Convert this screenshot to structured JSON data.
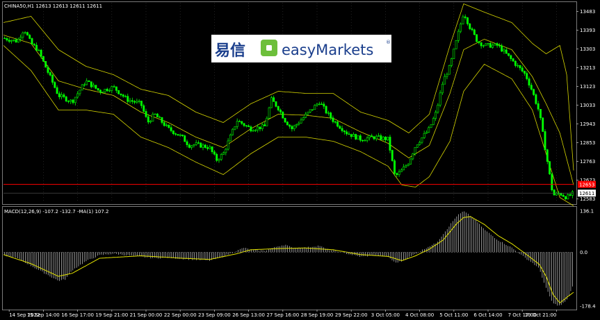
{
  "header": {
    "symbol_line": "CHINA50,H1  12613 12613 12611 12611",
    "macd_line": "MACD(12,26,9) -107.2 -132.7  -MA(1) 107.2"
  },
  "logo": {
    "cn_text": "易信",
    "brand_text": "easyMarkets",
    "reg_mark": "®"
  },
  "colors": {
    "background": "#000000",
    "bull": "#00ff00",
    "band": "#d7d700",
    "grid": "#3a3a3a",
    "level_line": "#ff0000",
    "macd_hist": "#d0d0d0",
    "signal": "#e6e600",
    "logo_blue": "#1a3e8c",
    "logo_green": "#6dbf3b"
  },
  "chart_data": [
    {
      "type": "candlestick",
      "ylim": [
        12565,
        13525
      ],
      "y_ticks": [
        13483,
        13393,
        13303,
        13213,
        13123,
        13033,
        12943,
        12853,
        12763,
        12673,
        12583
      ],
      "current_price": 12611,
      "current_price_label": "12611",
      "level_price": 12653,
      "level_price_label": "12653",
      "close_path": [
        [
          0,
          13355
        ],
        [
          2,
          13340
        ],
        [
          3,
          13400
        ],
        [
          4,
          13330
        ],
        [
          5,
          13300
        ],
        [
          8,
          13080
        ],
        [
          10,
          13050
        ],
        [
          12,
          13150
        ],
        [
          14,
          13100
        ],
        [
          16,
          13120
        ],
        [
          18,
          13060
        ],
        [
          20,
          13040
        ],
        [
          21,
          12950
        ],
        [
          22,
          12990
        ],
        [
          24,
          12920
        ],
        [
          26,
          12880
        ],
        [
          27,
          12840
        ],
        [
          28,
          12845
        ],
        [
          30,
          12830
        ],
        [
          31,
          12770
        ],
        [
          32,
          12800
        ],
        [
          34,
          12960
        ],
        [
          35,
          12940
        ],
        [
          36,
          12920
        ],
        [
          38,
          12930
        ],
        [
          39,
          13060
        ],
        [
          40,
          13020
        ],
        [
          41,
          12960
        ],
        [
          42,
          12920
        ],
        [
          44,
          12985
        ],
        [
          46,
          13050
        ],
        [
          47,
          13000
        ],
        [
          48,
          12960
        ],
        [
          50,
          12900
        ],
        [
          52,
          12870
        ],
        [
          54,
          12880
        ],
        [
          56,
          12870
        ],
        [
          57,
          12690
        ],
        [
          58,
          12720
        ],
        [
          59,
          12760
        ],
        [
          60,
          12840
        ],
        [
          62,
          12920
        ],
        [
          63,
          13000
        ],
        [
          64,
          13150
        ],
        [
          65,
          13220
        ],
        [
          66,
          13350
        ],
        [
          67,
          13480
        ],
        [
          68,
          13400
        ],
        [
          69,
          13340
        ],
        [
          70,
          13320
        ],
        [
          72,
          13320
        ],
        [
          74,
          13250
        ],
        [
          76,
          13180
        ],
        [
          77,
          13100
        ],
        [
          78,
          13000
        ],
        [
          79,
          12800
        ],
        [
          80,
          12600
        ],
        [
          81,
          12610
        ],
        [
          82,
          12590
        ],
        [
          83,
          12611
        ]
      ],
      "upper_band": [
        [
          0,
          13430
        ],
        [
          4,
          13460
        ],
        [
          8,
          13300
        ],
        [
          12,
          13220
        ],
        [
          16,
          13180
        ],
        [
          20,
          13110
        ],
        [
          24,
          13080
        ],
        [
          28,
          13000
        ],
        [
          32,
          12950
        ],
        [
          36,
          13040
        ],
        [
          40,
          13100
        ],
        [
          44,
          13090
        ],
        [
          48,
          13090
        ],
        [
          52,
          13000
        ],
        [
          56,
          12960
        ],
        [
          59,
          12900
        ],
        [
          62,
          12990
        ],
        [
          65,
          13320
        ],
        [
          67,
          13520
        ],
        [
          70,
          13480
        ],
        [
          74,
          13430
        ],
        [
          77,
          13330
        ],
        [
          79,
          13280
        ],
        [
          81,
          13320
        ],
        [
          82,
          13180
        ],
        [
          83,
          12720
        ]
      ],
      "lower_band": [
        [
          0,
          13320
        ],
        [
          4,
          13200
        ],
        [
          8,
          13010
        ],
        [
          12,
          13010
        ],
        [
          16,
          12990
        ],
        [
          20,
          12880
        ],
        [
          24,
          12830
        ],
        [
          28,
          12760
        ],
        [
          32,
          12700
        ],
        [
          36,
          12800
        ],
        [
          40,
          12880
        ],
        [
          44,
          12880
        ],
        [
          48,
          12860
        ],
        [
          52,
          12810
        ],
        [
          56,
          12740
        ],
        [
          58,
          12650
        ],
        [
          60,
          12640
        ],
        [
          62,
          12690
        ],
        [
          65,
          12860
        ],
        [
          67,
          13100
        ],
        [
          70,
          13230
        ],
        [
          74,
          13160
        ],
        [
          77,
          13010
        ],
        [
          79,
          12800
        ],
        [
          81,
          12590
        ],
        [
          83,
          12550
        ]
      ],
      "middle_band": [
        [
          0,
          13370
        ],
        [
          4,
          13330
        ],
        [
          8,
          13150
        ],
        [
          12,
          13110
        ],
        [
          16,
          13080
        ],
        [
          20,
          13000
        ],
        [
          24,
          12950
        ],
        [
          28,
          12880
        ],
        [
          32,
          12830
        ],
        [
          36,
          12920
        ],
        [
          40,
          12990
        ],
        [
          44,
          12985
        ],
        [
          48,
          12970
        ],
        [
          52,
          12905
        ],
        [
          56,
          12850
        ],
        [
          59,
          12780
        ],
        [
          62,
          12840
        ],
        [
          65,
          13090
        ],
        [
          67,
          13300
        ],
        [
          70,
          13350
        ],
        [
          74,
          13300
        ],
        [
          77,
          13170
        ],
        [
          79,
          13040
        ],
        [
          81,
          12900
        ],
        [
          83,
          12650
        ]
      ]
    },
    {
      "type": "bar",
      "ylim": [
        -188,
        148
      ],
      "y_ticks": [
        136.1,
        0.0,
        -178.4
      ],
      "histogram": [
        [
          0,
          -10
        ],
        [
          2,
          -20
        ],
        [
          4,
          -45
        ],
        [
          6,
          -70
        ],
        [
          8,
          -95
        ],
        [
          9,
          -90
        ],
        [
          10,
          -60
        ],
        [
          12,
          -30
        ],
        [
          14,
          -10
        ],
        [
          16,
          -5
        ],
        [
          18,
          -10
        ],
        [
          20,
          -15
        ],
        [
          22,
          -20
        ],
        [
          24,
          -18
        ],
        [
          26,
          -22
        ],
        [
          28,
          -25
        ],
        [
          30,
          -28
        ],
        [
          32,
          -15
        ],
        [
          34,
          5
        ],
        [
          35,
          15
        ],
        [
          36,
          8
        ],
        [
          38,
          5
        ],
        [
          40,
          20
        ],
        [
          41,
          25
        ],
        [
          42,
          15
        ],
        [
          44,
          15
        ],
        [
          46,
          22
        ],
        [
          47,
          10
        ],
        [
          48,
          5
        ],
        [
          50,
          -5
        ],
        [
          52,
          -15
        ],
        [
          54,
          -10
        ],
        [
          56,
          -15
        ],
        [
          57,
          -35
        ],
        [
          58,
          -30
        ],
        [
          60,
          -5
        ],
        [
          62,
          20
        ],
        [
          63,
          30
        ],
        [
          64,
          60
        ],
        [
          65,
          90
        ],
        [
          66,
          120
        ],
        [
          67,
          136
        ],
        [
          68,
          120
        ],
        [
          69,
          100
        ],
        [
          70,
          75
        ],
        [
          72,
          40
        ],
        [
          74,
          15
        ],
        [
          76,
          -20
        ],
        [
          77,
          -35
        ],
        [
          78,
          -55
        ],
        [
          79,
          -120
        ],
        [
          80,
          -170
        ],
        [
          81,
          -178
        ],
        [
          82,
          -160
        ],
        [
          83,
          -107
        ]
      ],
      "signal": [
        [
          0,
          -8
        ],
        [
          4,
          -38
        ],
        [
          8,
          -80
        ],
        [
          10,
          -70
        ],
        [
          14,
          -20
        ],
        [
          20,
          -12
        ],
        [
          26,
          -20
        ],
        [
          30,
          -24
        ],
        [
          34,
          -5
        ],
        [
          36,
          8
        ],
        [
          40,
          12
        ],
        [
          44,
          14
        ],
        [
          48,
          8
        ],
        [
          52,
          -8
        ],
        [
          56,
          -14
        ],
        [
          58,
          -28
        ],
        [
          60,
          -12
        ],
        [
          62,
          10
        ],
        [
          64,
          40
        ],
        [
          66,
          95
        ],
        [
          67,
          115
        ],
        [
          68,
          118
        ],
        [
          70,
          92
        ],
        [
          72,
          55
        ],
        [
          74,
          28
        ],
        [
          76,
          -5
        ],
        [
          78,
          -40
        ],
        [
          79,
          -80
        ],
        [
          80,
          -140
        ],
        [
          81,
          -168
        ],
        [
          82,
          -150
        ],
        [
          83,
          -133
        ]
      ]
    }
  ],
  "x_axis": {
    "labels": [
      {
        "i": 1,
        "text": "14 Sep 2022"
      },
      {
        "i": 7,
        "text": "15 Sep 14:00"
      },
      {
        "i": 13,
        "text": "16 Sep 17:00"
      },
      {
        "i": 19,
        "text": "19 Sep 21:00"
      },
      {
        "i": 25,
        "text": "21 Sep 00:00"
      },
      {
        "i": 31,
        "text": "22 Sep 00:00"
      },
      {
        "i": 37,
        "text": "23 Sep 09:00"
      },
      {
        "i": 43,
        "text": "26 Sep 13:00"
      },
      {
        "i": 49,
        "text": "27 Sep 16:00"
      },
      {
        "i": 55,
        "text": "28 Sep 19:00"
      },
      {
        "i": 61,
        "text": "29 Sep 22:00"
      },
      {
        "i": 67,
        "text": "3 Oct 05:00"
      },
      {
        "i": 73,
        "text": "4 Oct 08:00"
      },
      {
        "i": 79,
        "text": "5 Oct 11:00"
      },
      {
        "i": 85,
        "text": "6 Oct 14:00"
      },
      {
        "i": 91,
        "text": "7 Oct 17:00"
      },
      {
        "i": 97,
        "text": "10 Oct 21:00"
      }
    ]
  }
}
